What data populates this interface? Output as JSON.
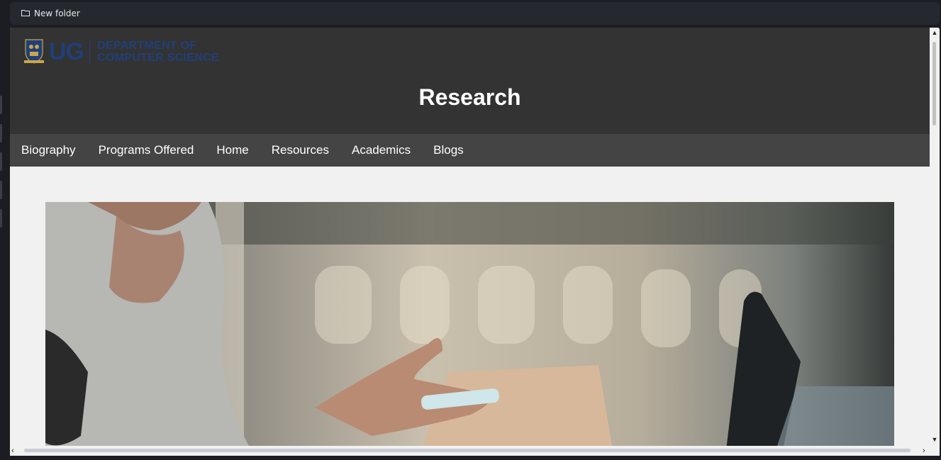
{
  "bookmarks_bar": {
    "items": [
      {
        "label": "New folder",
        "icon": "folder-icon"
      }
    ]
  },
  "header": {
    "logo": {
      "mark": "UG",
      "dept_line1": "DEPARTMENT OF",
      "dept_line2": "COMPUTER SCIENCE",
      "color": "#203f7a"
    },
    "title": "Research",
    "background": "#333333"
  },
  "nav": {
    "background": "#444444",
    "items": [
      {
        "label": "Biography"
      },
      {
        "label": "Programs Offered"
      },
      {
        "label": "Home"
      },
      {
        "label": "Resources"
      },
      {
        "label": "Academics"
      },
      {
        "label": "Blogs"
      }
    ]
  },
  "main": {
    "background": "#f1f1f1",
    "hero_image": "person-with-phone-and-laptop-photo"
  }
}
